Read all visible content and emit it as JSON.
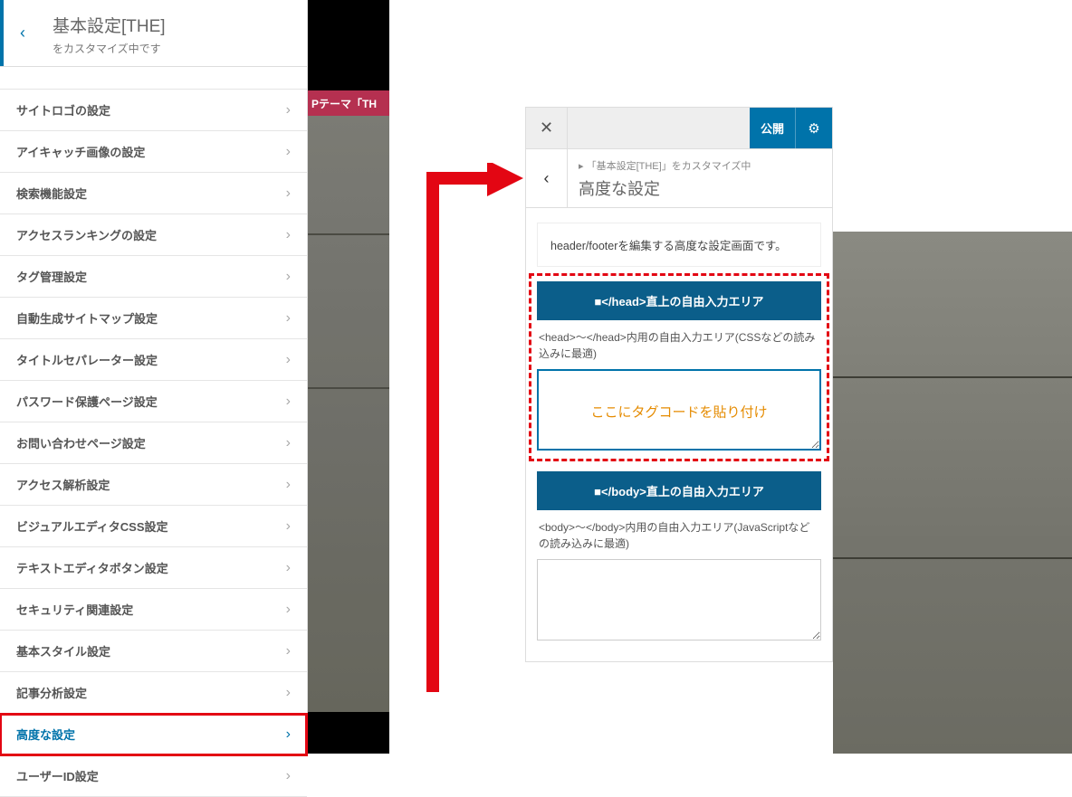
{
  "left": {
    "title": "基本設定[THE]",
    "subtitle": "をカスタマイズ中です",
    "menu": [
      "サイトロゴの設定",
      "アイキャッチ画像の設定",
      "検索機能設定",
      "アクセスランキングの設定",
      "タグ管理設定",
      "自動生成サイトマップ設定",
      "タイトルセパレーター設定",
      "パスワード保護ページ設定",
      "お問い合わせページ設定",
      "アクセス解析設定",
      "ビジュアルエディタCSS設定",
      "テキストエディタボタン設定",
      "セキュリティ関連設定",
      "基本スタイル設定",
      "記事分析設定",
      "高度な設定",
      "ユーザーID設定"
    ],
    "highlight_index": 15
  },
  "preview": {
    "pink_bar_text": "Pテーマ「TH"
  },
  "right": {
    "publish_label": "公開",
    "breadcrumb_prefix": "▸ 「基本設定[THE]」をカスタマイズ中",
    "breadcrumb_title": "高度な設定",
    "description": "header/footerを編集する高度な設定画面です。",
    "section1": {
      "header": "■</head>直上の自由入力エリア",
      "sub": "<head>～</head>内用の自由入力エリア(CSSなどの読み込みに最適)",
      "placeholder_overlay": "ここにタグコードを貼り付け"
    },
    "section2": {
      "header": "■</body>直上の自由入力エリア",
      "sub": "<body>～</body>内用の自由入力エリア(JavaScriptなどの読み込みに最適)"
    }
  }
}
